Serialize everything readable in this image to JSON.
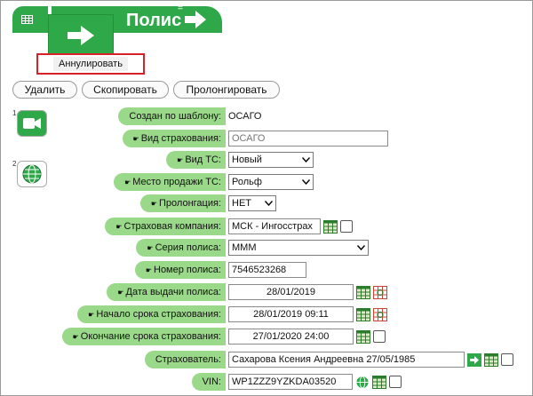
{
  "header": {
    "title": "Полис"
  },
  "actions": {
    "annul": "Аннулировать",
    "delete": "Удалить",
    "copy": "Скопировать",
    "prolong": "Пролонгировать"
  },
  "side": {
    "num1": "1",
    "num2": "2"
  },
  "fields": {
    "template": {
      "label": "Создан по шаблону:",
      "value": "ОСАГО"
    },
    "ins_type": {
      "label": "Вид страхования:",
      "placeholder": "ОСАГО"
    },
    "vehicle_type": {
      "label": "Вид ТС:",
      "value": "Новый"
    },
    "sale_place": {
      "label": "Место продажи ТС:",
      "value": "Рольф"
    },
    "prolongation": {
      "label": "Пролонгация:",
      "value": "НЕТ"
    },
    "company": {
      "label": "Страховая компания:",
      "value": "МСК - Ингосстрах"
    },
    "series": {
      "label": "Серия полиса:",
      "value": "МММ"
    },
    "number": {
      "label": "Номер полиса:",
      "value": "7546523268"
    },
    "issue_date": {
      "label": "Дата выдачи полиса:",
      "value": "28/01/2019"
    },
    "start": {
      "label": "Начало срока страхования:",
      "value": "28/01/2019 09:11"
    },
    "end": {
      "label": "Окончание срока страхования:",
      "value": "27/01/2020 24:00"
    },
    "insurer": {
      "label": "Страхователь:",
      "value": "Сахарова Ксения Андреевна 27/05/1985"
    },
    "vin": {
      "label": "VIN:",
      "value": "WP1ZZZ9YZKDA03520"
    }
  },
  "colors": {
    "accent": "#2fa84a",
    "label_bg": "#9bd98a",
    "highlight": "#d8222a"
  }
}
